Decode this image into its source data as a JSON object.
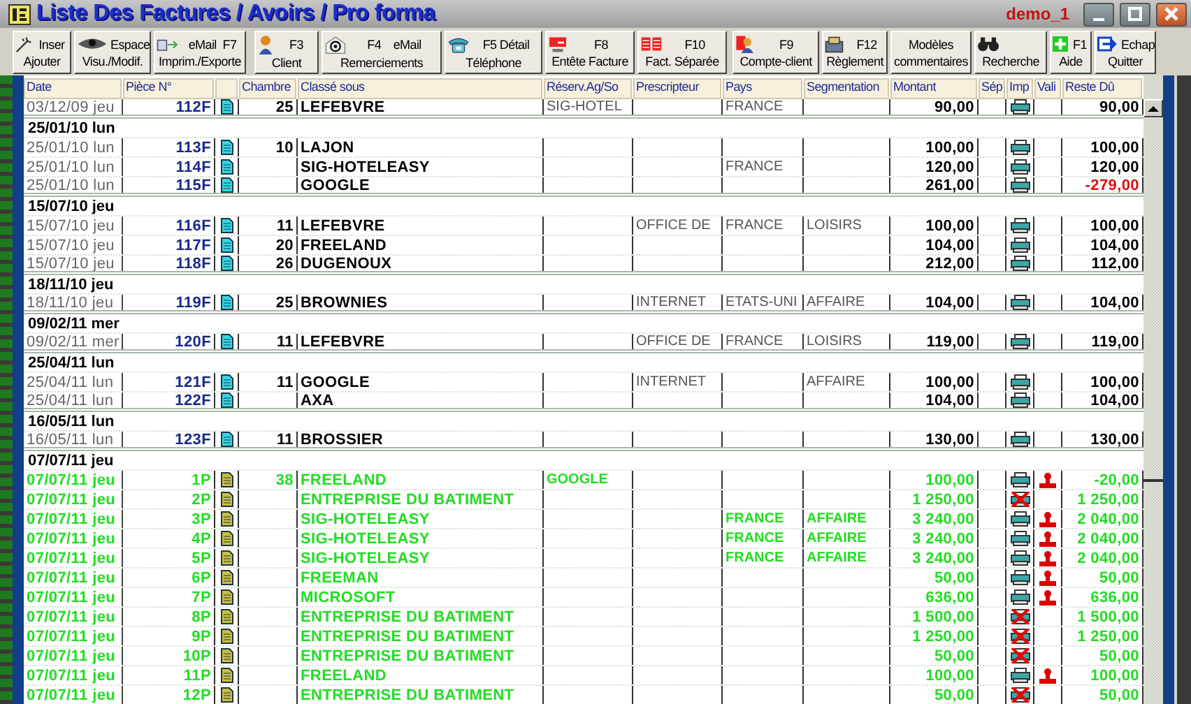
{
  "window": {
    "title": "Liste Des Factures / Avoirs / Pro forma",
    "user": "demo_1"
  },
  "toolbar": [
    {
      "top": "Inser",
      "bottom": "Ajouter"
    },
    {
      "top": "Espace",
      "bottom": "Visu./Modif."
    },
    {
      "top": "eMail  F7",
      "bottom": "Imprim./Exporte"
    },
    {
      "top": "F3",
      "bottom": "Client"
    },
    {
      "top": "F4    eMail",
      "bottom": "Remerciements"
    },
    {
      "top": "F5 Détail",
      "bottom": "Téléphone"
    },
    {
      "top": "F8",
      "bottom": "Entête Facture"
    },
    {
      "top": "F10",
      "bottom": "Fact. Séparée"
    },
    {
      "top": "F9",
      "bottom": "Compte-client"
    },
    {
      "top": "F12",
      "bottom": "Règlement"
    },
    {
      "top": "Modèles",
      "bottom": "commentaires"
    },
    {
      "bottom": "Recherche"
    },
    {
      "top": "F1",
      "bottom": "Aide"
    },
    {
      "top": "Echap",
      "bottom": "Quitter"
    }
  ],
  "table": {
    "columns": [
      "Date",
      "Pièce N°",
      "Chambre",
      "Classé sous",
      "Réserv.Ag/So",
      "Prescripteur",
      "Pays",
      "Segmentation",
      "Montant",
      "Sép",
      "Imp",
      "Vali",
      "Reste Dû"
    ],
    "rows": [
      {
        "kind": "invoice",
        "date": "03/12/09 jeu",
        "piece": "112F",
        "chambre": "25",
        "classe": "LEFEBVRE",
        "reserv": "SIG-HOTEL",
        "pays": "FRANCE",
        "montant": "90,00",
        "reste": "90,00",
        "proforma": false,
        "print_blocked": false,
        "validated": false,
        "alert": false
      },
      {
        "kind": "group",
        "date": "25/01/10 lun"
      },
      {
        "kind": "invoice",
        "date": "25/01/10 lun",
        "piece": "113F",
        "chambre": "10",
        "classe": "LAJON",
        "montant": "100,00",
        "reste": "100,00",
        "proforma": false,
        "print_blocked": false,
        "validated": false,
        "alert": false
      },
      {
        "kind": "invoice",
        "date": "25/01/10 lun",
        "piece": "114F",
        "classe": "SIG-HOTELEASY",
        "pays": "FRANCE",
        "montant": "120,00",
        "reste": "120,00",
        "proforma": false,
        "print_blocked": false,
        "validated": false,
        "alert": false
      },
      {
        "kind": "invoice",
        "date": "25/01/10 lun",
        "piece": "115F",
        "classe": "GOOGLE",
        "montant": "261,00",
        "reste": "-279,00",
        "proforma": false,
        "print_blocked": false,
        "validated": false,
        "alert": true
      },
      {
        "kind": "group",
        "date": "15/07/10 jeu"
      },
      {
        "kind": "invoice",
        "date": "15/07/10 jeu",
        "piece": "116F",
        "chambre": "11",
        "classe": "LEFEBVRE",
        "prescripteur": "OFFICE DE",
        "pays": "FRANCE",
        "segmentation": "LOISIRS",
        "montant": "100,00",
        "reste": "100,00",
        "proforma": false,
        "print_blocked": false,
        "validated": false,
        "alert": false
      },
      {
        "kind": "invoice",
        "date": "15/07/10 jeu",
        "piece": "117F",
        "chambre": "20",
        "classe": "FREELAND",
        "montant": "104,00",
        "reste": "104,00",
        "proforma": false,
        "print_blocked": false,
        "validated": false,
        "alert": false
      },
      {
        "kind": "invoice",
        "date": "15/07/10 jeu",
        "piece": "118F",
        "chambre": "26",
        "classe": "DUGENOUX",
        "montant": "212,00",
        "reste": "112,00",
        "proforma": false,
        "print_blocked": false,
        "validated": false,
        "alert": false
      },
      {
        "kind": "group",
        "date": "18/11/10 jeu"
      },
      {
        "kind": "invoice",
        "date": "18/11/10 jeu",
        "piece": "119F",
        "chambre": "25",
        "classe": "BROWNIES",
        "prescripteur": "INTERNET",
        "pays": "ETATS-UNI",
        "segmentation": "AFFAIRE",
        "montant": "104,00",
        "reste": "104,00",
        "proforma": false,
        "print_blocked": false,
        "validated": false,
        "alert": false
      },
      {
        "kind": "group",
        "date": "09/02/11 mer"
      },
      {
        "kind": "invoice",
        "date": "09/02/11 mer",
        "piece": "120F",
        "chambre": "11",
        "classe": "LEFEBVRE",
        "prescripteur": "OFFICE DE",
        "pays": "FRANCE",
        "segmentation": "LOISIRS",
        "montant": "119,00",
        "reste": "119,00",
        "proforma": false,
        "print_blocked": false,
        "validated": false,
        "alert": false
      },
      {
        "kind": "group",
        "date": "25/04/11 lun"
      },
      {
        "kind": "invoice",
        "date": "25/04/11 lun",
        "piece": "121F",
        "chambre": "11",
        "classe": "GOOGLE",
        "prescripteur": "INTERNET",
        "segmentation": "AFFAIRE",
        "montant": "100,00",
        "reste": "100,00",
        "proforma": false,
        "print_blocked": false,
        "validated": false,
        "alert": false
      },
      {
        "kind": "invoice",
        "date": "25/04/11 lun",
        "piece": "122F",
        "classe": "AXA",
        "montant": "104,00",
        "reste": "104,00",
        "proforma": false,
        "print_blocked": false,
        "validated": false,
        "alert": false
      },
      {
        "kind": "group",
        "date": "16/05/11 lun"
      },
      {
        "kind": "invoice",
        "date": "16/05/11 lun",
        "piece": "123F",
        "chambre": "11",
        "classe": "BROSSIER",
        "montant": "130,00",
        "reste": "130,00",
        "proforma": false,
        "print_blocked": false,
        "validated": false,
        "alert": false
      },
      {
        "kind": "group",
        "date": "07/07/11 jeu"
      },
      {
        "kind": "invoice",
        "date": "07/07/11 jeu",
        "piece": "1P",
        "chambre": "38",
        "classe": "FREELAND",
        "reserv": "GOOGLE",
        "montant": "100,00",
        "reste": "-20,00",
        "proforma": true,
        "print_blocked": false,
        "validated": true,
        "alert": false
      },
      {
        "kind": "invoice",
        "date": "07/07/11 jeu",
        "piece": "2P",
        "classe": "ENTREPRISE DU BATIMENT",
        "montant": "1 250,00",
        "reste": "1 250,00",
        "proforma": true,
        "print_blocked": true,
        "validated": false,
        "alert": false
      },
      {
        "kind": "invoice",
        "date": "07/07/11 jeu",
        "piece": "3P",
        "classe": "SIG-HOTELEASY",
        "pays": "FRANCE",
        "segmentation": "AFFAIRE",
        "montant": "3 240,00",
        "reste": "2 040,00",
        "proforma": true,
        "print_blocked": false,
        "validated": true,
        "alert": false
      },
      {
        "kind": "invoice",
        "date": "07/07/11 jeu",
        "piece": "4P",
        "classe": "SIG-HOTELEASY",
        "pays": "FRANCE",
        "segmentation": "AFFAIRE",
        "montant": "3 240,00",
        "reste": "2 040,00",
        "proforma": true,
        "print_blocked": false,
        "validated": true,
        "alert": false
      },
      {
        "kind": "invoice",
        "date": "07/07/11 jeu",
        "piece": "5P",
        "classe": "SIG-HOTELEASY",
        "pays": "FRANCE",
        "segmentation": "AFFAIRE",
        "montant": "3 240,00",
        "reste": "2 040,00",
        "proforma": true,
        "print_blocked": false,
        "validated": true,
        "alert": false
      },
      {
        "kind": "invoice",
        "date": "07/07/11 jeu",
        "piece": "6P",
        "classe": "FREEMAN",
        "montant": "50,00",
        "reste": "50,00",
        "proforma": true,
        "print_blocked": false,
        "validated": true,
        "alert": false
      },
      {
        "kind": "invoice",
        "date": "07/07/11 jeu",
        "piece": "7P",
        "classe": "MICROSOFT",
        "montant": "636,00",
        "reste": "636,00",
        "proforma": true,
        "print_blocked": false,
        "validated": true,
        "alert": false
      },
      {
        "kind": "invoice",
        "date": "07/07/11 jeu",
        "piece": "8P",
        "classe": "ENTREPRISE DU BATIMENT",
        "montant": "1 500,00",
        "reste": "1 500,00",
        "proforma": true,
        "print_blocked": true,
        "validated": false,
        "alert": false
      },
      {
        "kind": "invoice",
        "date": "07/07/11 jeu",
        "piece": "9P",
        "classe": "ENTREPRISE DU BATIMENT",
        "montant": "1 250,00",
        "reste": "1 250,00",
        "proforma": true,
        "print_blocked": true,
        "validated": false,
        "alert": false
      },
      {
        "kind": "invoice",
        "date": "07/07/11 jeu",
        "piece": "10P",
        "classe": "ENTREPRISE DU BATIMENT",
        "montant": "50,00",
        "reste": "50,00",
        "proforma": true,
        "print_blocked": true,
        "validated": false,
        "alert": false
      },
      {
        "kind": "invoice",
        "date": "07/07/11 jeu",
        "piece": "11P",
        "classe": "FREELAND",
        "montant": "100,00",
        "reste": "100,00",
        "proforma": true,
        "print_blocked": false,
        "validated": true,
        "alert": false
      },
      {
        "kind": "invoice",
        "date": "07/07/11 jeu",
        "piece": "12P",
        "classe": "ENTREPRISE DU BATIMENT",
        "montant": "50,00",
        "reste": "50,00",
        "proforma": true,
        "print_blocked": true,
        "validated": false,
        "alert": false
      }
    ]
  }
}
